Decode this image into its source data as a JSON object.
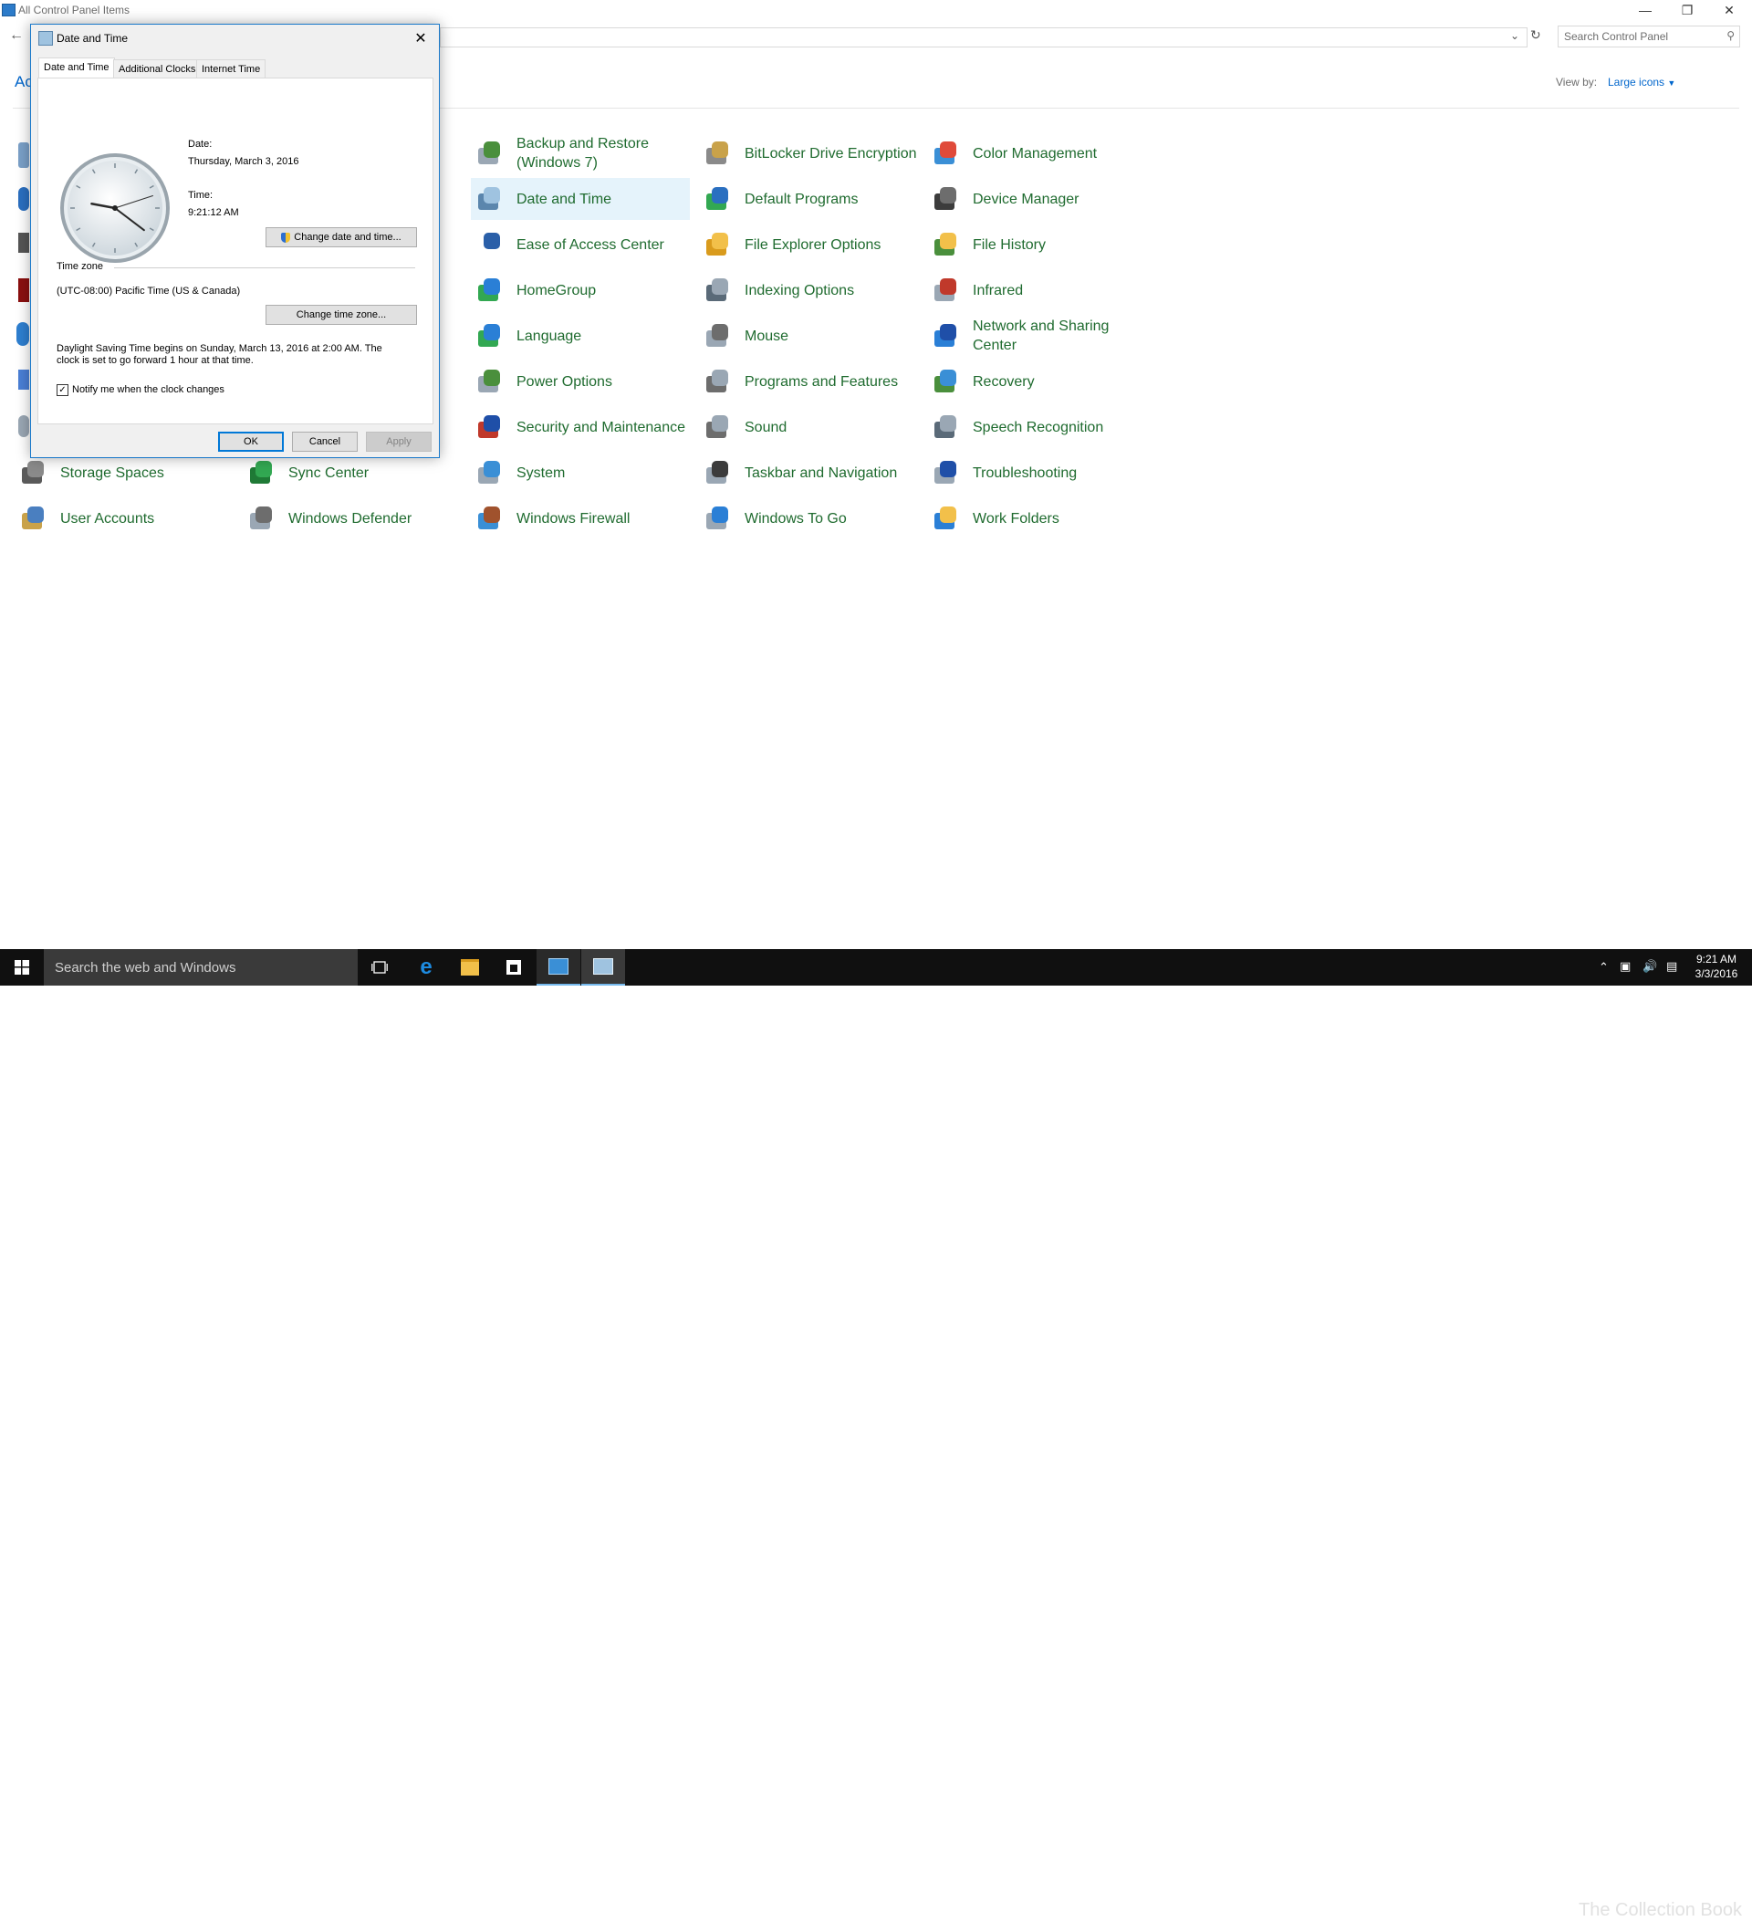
{
  "window": {
    "title": "All Control Panel Items",
    "search_placeholder": "Search Control Panel",
    "partial_left_text": "Ac",
    "view_by_label": "View by:",
    "view_by_value": "Large icons"
  },
  "items": [
    {
      "label": "Backup and Restore\n(Windows 7)",
      "icon": "backup-restore-icon",
      "col": 2,
      "row": 0
    },
    {
      "label": "BitLocker Drive Encryption",
      "icon": "bitlocker-icon",
      "col": 3,
      "row": 0
    },
    {
      "label": "Color Management",
      "icon": "color-management-icon",
      "col": 4,
      "row": 0
    },
    {
      "label": "Date and Time",
      "icon": "date-time-icon",
      "col": 2,
      "row": 1,
      "selected": true
    },
    {
      "label": "Default Programs",
      "icon": "default-programs-icon",
      "col": 3,
      "row": 1
    },
    {
      "label": "Device Manager",
      "icon": "device-manager-icon",
      "col": 4,
      "row": 1
    },
    {
      "label": "Ease of Access Center",
      "icon": "ease-of-access-icon",
      "col": 2,
      "row": 2
    },
    {
      "label": "File Explorer Options",
      "icon": "file-explorer-options-icon",
      "col": 3,
      "row": 2
    },
    {
      "label": "File History",
      "icon": "file-history-icon",
      "col": 4,
      "row": 2
    },
    {
      "label": "HomeGroup",
      "icon": "homegroup-icon",
      "col": 2,
      "row": 3
    },
    {
      "label": "Indexing Options",
      "icon": "indexing-options-icon",
      "col": 3,
      "row": 3
    },
    {
      "label": "Infrared",
      "icon": "infrared-icon",
      "col": 4,
      "row": 3
    },
    {
      "label": "Language",
      "icon": "language-icon",
      "col": 2,
      "row": 4
    },
    {
      "label": "Mouse",
      "icon": "mouse-icon",
      "col": 3,
      "row": 4
    },
    {
      "label": "Network and Sharing\nCenter",
      "icon": "network-sharing-icon",
      "col": 4,
      "row": 4
    },
    {
      "label": "Power Options",
      "icon": "power-options-icon",
      "col": 2,
      "row": 5
    },
    {
      "label": "Programs and Features",
      "icon": "programs-features-icon",
      "col": 3,
      "row": 5
    },
    {
      "label": "Recovery",
      "icon": "recovery-icon",
      "col": 4,
      "row": 5
    },
    {
      "label": "Security and Maintenance",
      "icon": "security-maintenance-icon",
      "col": 2,
      "row": 6
    },
    {
      "label": "Sound",
      "icon": "sound-icon",
      "col": 3,
      "row": 6
    },
    {
      "label": "Speech Recognition",
      "icon": "speech-recognition-icon",
      "col": 4,
      "row": 6
    },
    {
      "label": "Storage Spaces",
      "icon": "storage-spaces-icon",
      "col": 0,
      "row": 7
    },
    {
      "label": "Sync Center",
      "icon": "sync-center-icon",
      "col": 1,
      "row": 7
    },
    {
      "label": "System",
      "icon": "system-icon",
      "col": 2,
      "row": 7
    },
    {
      "label": "Taskbar and Navigation",
      "icon": "taskbar-navigation-icon",
      "col": 3,
      "row": 7
    },
    {
      "label": "Troubleshooting",
      "icon": "troubleshooting-icon",
      "col": 4,
      "row": 7
    },
    {
      "label": "User Accounts",
      "icon": "user-accounts-icon",
      "col": 0,
      "row": 8
    },
    {
      "label": "Windows Defender",
      "icon": "windows-defender-icon",
      "col": 1,
      "row": 8
    },
    {
      "label": "Windows Firewall",
      "icon": "windows-firewall-icon",
      "col": 2,
      "row": 8
    },
    {
      "label": "Windows To Go",
      "icon": "windows-to-go-icon",
      "col": 3,
      "row": 8
    },
    {
      "label": "Work Folders",
      "icon": "work-folders-icon",
      "col": 4,
      "row": 8
    }
  ],
  "dialog": {
    "title": "Date and Time",
    "tabs": [
      "Date and Time",
      "Additional Clocks",
      "Internet Time"
    ],
    "date_label": "Date:",
    "date_value": "Thursday, March 3, 2016",
    "time_label": "Time:",
    "time_value": "9:21:12 AM",
    "change_datetime_button": "Change date and time...",
    "timezone_header": "Time zone",
    "timezone_value": "(UTC-08:00) Pacific Time (US & Canada)",
    "change_timezone_button": "Change time zone...",
    "dst_line1": "Daylight Saving Time begins on Sunday, March 13, 2016 at 2:00 AM. The",
    "dst_line2": "clock is set to go forward 1 hour at that time.",
    "notify_label": "Notify me when the clock changes",
    "notify_checked": true,
    "ok": "OK",
    "cancel": "Cancel",
    "apply": "Apply"
  },
  "taskbar": {
    "search_text": "Search the web and Windows",
    "time": "9:21 AM",
    "date": "3/3/2016",
    "watermark": "The Collection Book"
  }
}
